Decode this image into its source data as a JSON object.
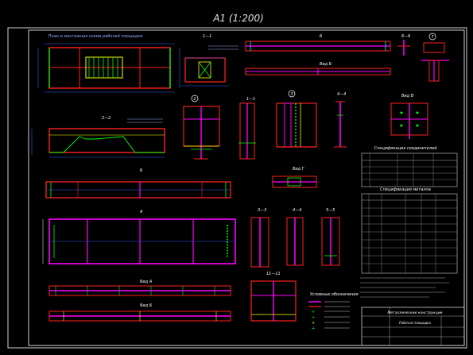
{
  "sheet": {
    "format_label": "A1 (1:200)"
  },
  "views": {
    "plan_title": "План и монтажная схема рабочей площадки",
    "section_1_1": "1—1",
    "view_B": "Б",
    "view_B2": "Вид Б",
    "section_6_6": "6—6",
    "node_7": "7",
    "node_2": "2",
    "section_1_1b": "1—1",
    "node_3": "3",
    "section_4_4": "4—4",
    "view_v": "Вид В",
    "section_2_2": "2—2",
    "view_g": "Вид Г",
    "beam_b": "Б",
    "beam_a": "А",
    "section_3_3": "3—3",
    "section_4_4b": "4—4",
    "section_5_5": "5—5",
    "section_11_11": "11—11",
    "view_a": "Вид А",
    "view_b3": "Вид Б",
    "legend_title": "Условные обозначения"
  },
  "tables": {
    "connections_title": "Спецификация соединителей",
    "materials_title": "Спецификация металла"
  },
  "titleblock": {
    "project": "Металлические конструкции",
    "drawing": "Рабочая площадка"
  },
  "colors": {
    "frame": "#ffffff",
    "beam": "#ff00ff",
    "red": "#ff2020",
    "green": "#00ff00",
    "yellow": "#ffff00",
    "cyan": "#00ffff",
    "blue": "#3060ff"
  }
}
